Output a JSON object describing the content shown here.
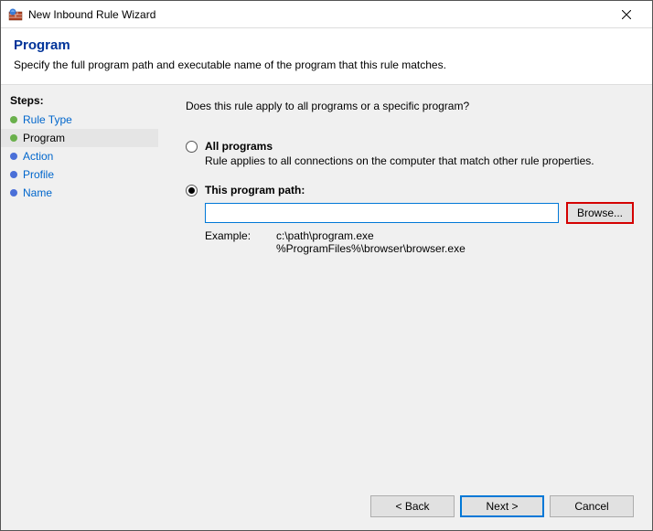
{
  "titlebar": {
    "title": "New Inbound Rule Wizard"
  },
  "header": {
    "title": "Program",
    "desc": "Specify the full program path and executable name of the program that this rule matches."
  },
  "sidebar": {
    "steps_label": "Steps:",
    "items": [
      {
        "label": "Rule Type"
      },
      {
        "label": "Program"
      },
      {
        "label": "Action"
      },
      {
        "label": "Profile"
      },
      {
        "label": "Name"
      }
    ]
  },
  "main": {
    "question": "Does this rule apply to all programs or a specific program?",
    "option_all": {
      "label": "All programs",
      "desc": "Rule applies to all connections on the computer that match other rule properties."
    },
    "option_path": {
      "label": "This program path:",
      "value": "",
      "browse": "Browse...",
      "example_label": "Example:",
      "example_text": "c:\\path\\program.exe\n%ProgramFiles%\\browser\\browser.exe"
    }
  },
  "footer": {
    "back": "< Back",
    "next": "Next >",
    "cancel": "Cancel"
  }
}
